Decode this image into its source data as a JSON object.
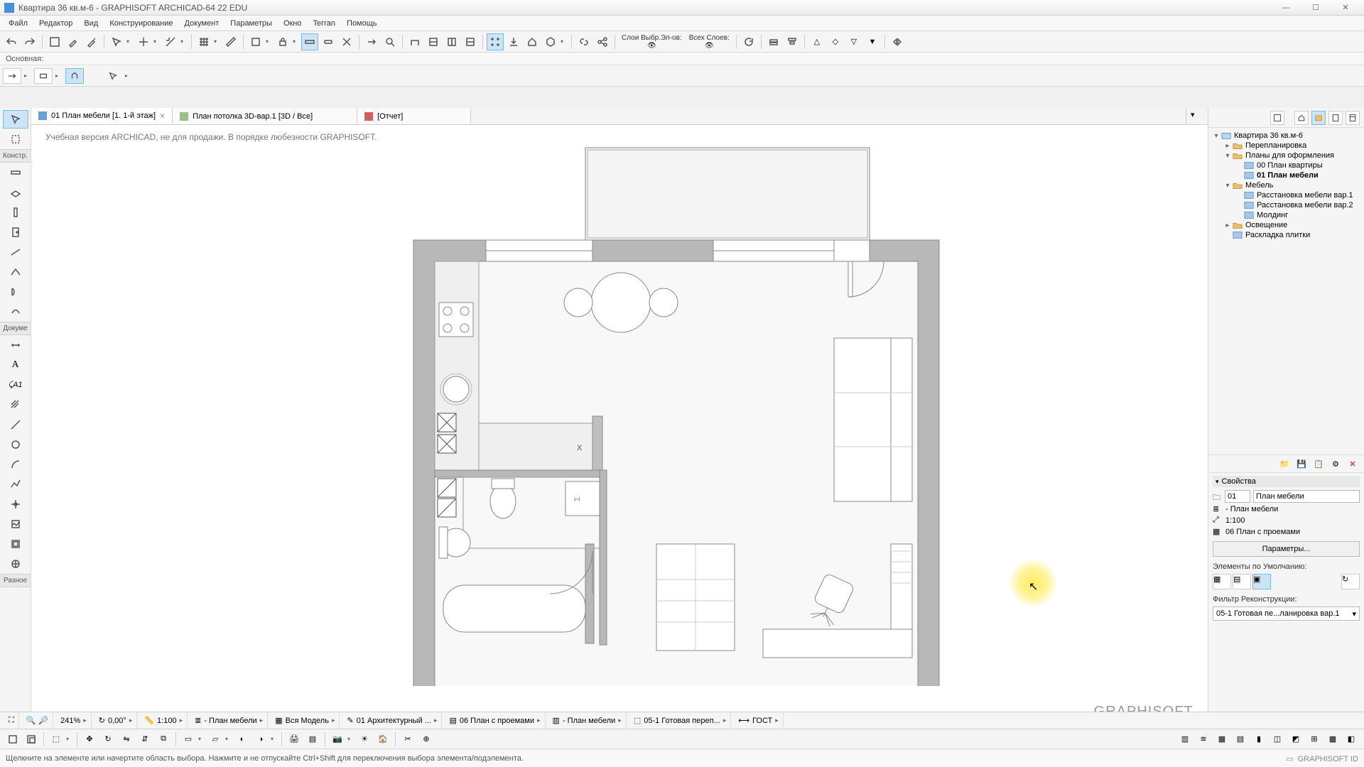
{
  "title": "Квартира 36 кв.м-6 - GRAPHISOFT ARCHICAD-64 22 EDU",
  "menu": [
    "Файл",
    "Редактор",
    "Вид",
    "Конструирование",
    "Документ",
    "Параметры",
    "Окно",
    "Teгran",
    "Помощь"
  ],
  "toolbar_labels": {
    "selection": "Слои Выбр.Эл-ов:",
    "all_layers": "Всех Слоев:"
  },
  "band2": "Основная:",
  "tabs": {
    "t1": "01 План мебели [1. 1-й этаж]",
    "t2": "План потолка 3D-вар.1 [3D / Все]",
    "t3": "[Отчет]"
  },
  "watermark": "Учебная версия ARCHICAD, не для продажи. В порядке любезности GRAPHISOFT.",
  "plan_marker": "X",
  "brand": "GRAPHISOFT.",
  "left_groups": {
    "g1": "Констр.",
    "g2": "Докуме",
    "g3": "Разное"
  },
  "nav": {
    "root": "Квартира 36 кв.м-6",
    "n1": "Перепланировка",
    "n2": "Планы для оформления",
    "n2a": "00 План квартиры",
    "n2b": "01 План мебели",
    "n3": "Мебель",
    "n3a": "Расстановка мебели вар.1",
    "n3b": "Расстановка мебели вар.2",
    "n3c": "Молдинг",
    "n4": "Освещение",
    "n5": "Раскладка плитки"
  },
  "props": {
    "header": "Свойства",
    "id": "01",
    "name": "План мебели",
    "layer_combo": "- План мебели",
    "scale": "1:100",
    "plan_type": "06 План с проемами",
    "params_btn": "Параметры...",
    "defaults_lbl": "Элементы по Умолчанию:",
    "recon_lbl": "Фильтр Реконструкции:",
    "recon_val": "05-1 Готовая пе...ланировка вар.1"
  },
  "status1": {
    "zoom": "241%",
    "angle": "0,00°",
    "scale": "1:100",
    "s1": "- План мебели",
    "s2": "Вся Модель",
    "s3": "01 Архитектурный ...",
    "s4": "06 План с проемами",
    "s5": "- План мебели",
    "s6": "05-1 Готовая переп...",
    "s7": "ГОСТ"
  },
  "hint": "Щелкните на элементе или начертите область выбора. Нажмите и не отпускайте Ctrl+Shift для переключения выбора элемента/подэлемента.",
  "gs_id": "GRAPHISOFT ID"
}
